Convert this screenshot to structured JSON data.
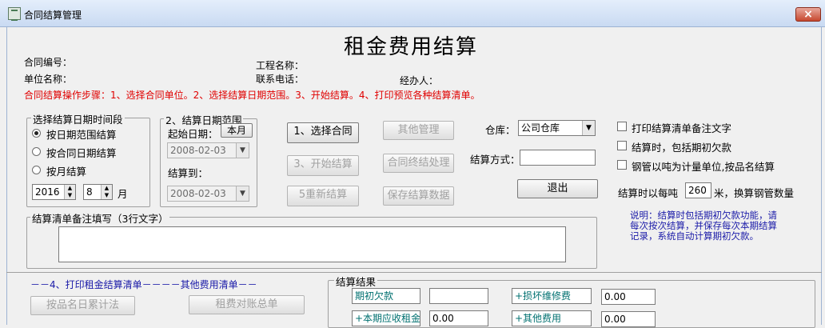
{
  "window": {
    "title": "合同结算管理",
    "close": "×"
  },
  "heading": "租金费用结算",
  "info": {
    "contract_no": "合同编号：",
    "project_name": "工程名称：",
    "unit_name": "单位名称：",
    "phone": "联系电话：",
    "handler": "经办人："
  },
  "steps_text": "合同结算操作步骤：1、选择合同单位。2、选择结算日期范围。3、开始结算。4、打印预览各种结算清单。",
  "period_group": {
    "label": "选择结算日期时间段",
    "options": [
      "按日期范围结算",
      "按合同日期结算",
      "按月结算"
    ],
    "selected": 0,
    "year": "2016",
    "month": "8",
    "month_unit": "月"
  },
  "range_group": {
    "label": "2、结算日期范围",
    "start_label": "起始日期：",
    "this_month": "本月",
    "start_date": "2008-02-03",
    "end_label": "结算到：",
    "end_date": "2008-02-03"
  },
  "buttons": {
    "select_contract": "1、选择合同",
    "start_settle": "3、开始结算",
    "resettle": "5重新结算",
    "other_mgmt": "其他管理",
    "contract_close": "合同终结处理",
    "save_data": "保存结算数据",
    "exit": "退出",
    "by_product_day": "按品名日累计法",
    "rent_total": "租费对账总单"
  },
  "warehouse": {
    "label": "仓库：",
    "value": "公司仓库"
  },
  "method": {
    "label": "结算方式：",
    "value": ""
  },
  "options": {
    "print_note": "打印结算清单备注文字",
    "include_initial": "结算时，包括期初欠款",
    "steel_by_ton": "钢管以吨为计量单位,按品名结算"
  },
  "per_ton": {
    "prefix": "结算时以每吨",
    "value": "260",
    "suffix": "米，换算钢管数量"
  },
  "note_group": {
    "label": "结算清单备注填写（3行文字）",
    "value": ""
  },
  "explain": "说明：结算时包括期初欠款功能，请每次按次结算，并保存每次本期结算记录，系统自动计算期初欠款。",
  "print_header": "－－4、打印租金结算清单－－－－其他费用清单－－",
  "result": {
    "label": "结算结果",
    "initial_debt": "期初欠款",
    "initial_debt_value": "",
    "repair_fee": "+损坏维修费",
    "repair_fee_value": "0.00",
    "current_rent": "+本期应收租金",
    "current_rent_value": "0.00",
    "other_fee": "+其他费用",
    "other_fee_value": "0.00"
  }
}
